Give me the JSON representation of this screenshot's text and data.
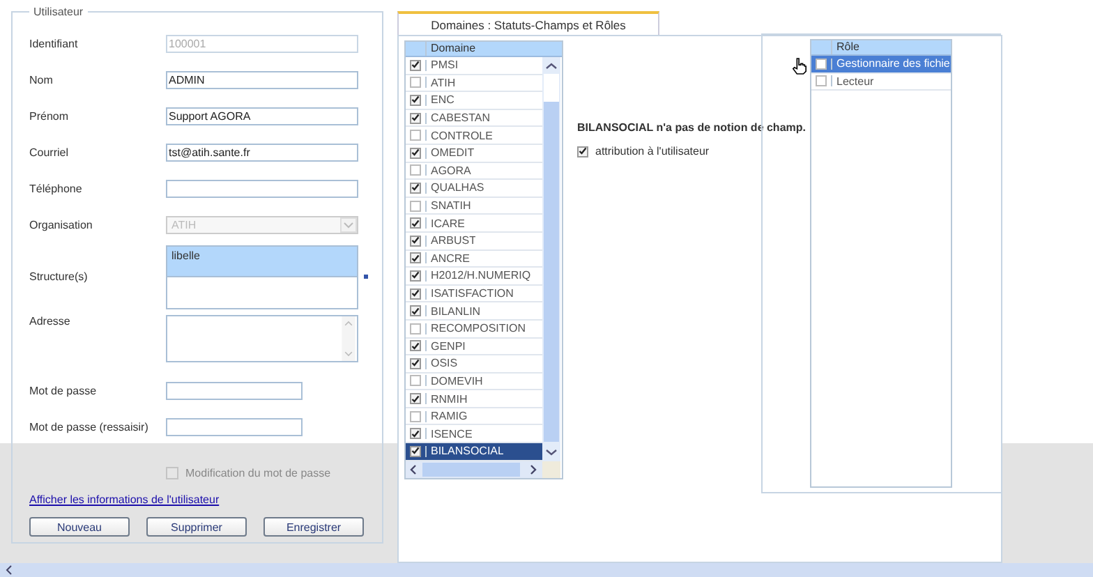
{
  "user_form": {
    "legend": "Utilisateur",
    "fields": [
      {
        "kind": "text",
        "label": "Identifiant",
        "value": "100001",
        "disabled": true
      },
      {
        "kind": "text",
        "label": "Nom",
        "value": "ADMIN",
        "disabled": false
      },
      {
        "kind": "text",
        "label": "Prénom",
        "value": "Support AGORA",
        "disabled": false
      },
      {
        "kind": "text",
        "label": "Courriel",
        "value": "tst@atih.sante.fr",
        "disabled": false
      },
      {
        "kind": "text",
        "label": "Téléphone",
        "disabled": false
      },
      {
        "kind": "select",
        "label": "Organisation",
        "value": "ATIH",
        "disabled": true
      },
      {
        "kind": "list",
        "label": "Structure(s)",
        "header": "libelle"
      },
      {
        "kind": "textarea",
        "label": "Adresse"
      },
      {
        "kind": "password",
        "label": "Mot de passe"
      },
      {
        "kind": "password",
        "label": "Mot de passe (ressaisir)"
      }
    ],
    "password_change": {
      "label": "Modification du mot de passe",
      "checked": false,
      "disabled": true
    },
    "info_link": "Afficher les informations de l'utilisateur",
    "buttons": [
      "Nouveau",
      "Supprimer",
      "Enregistrer"
    ]
  },
  "tabs": [
    {
      "label": "Domaines : Statuts-Champs et Rôles",
      "selected": true
    }
  ],
  "domains": {
    "header": "Domaine",
    "rows": [
      {
        "name": "PMSI",
        "checked": true,
        "selected": false
      },
      {
        "name": "ATIH",
        "checked": false,
        "selected": false
      },
      {
        "name": "ENC",
        "checked": true,
        "selected": false
      },
      {
        "name": "CABESTAN",
        "checked": true,
        "selected": false
      },
      {
        "name": "CONTROLE",
        "checked": false,
        "selected": false
      },
      {
        "name": "OMEDIT",
        "checked": true,
        "selected": false
      },
      {
        "name": "AGORA",
        "checked": false,
        "selected": false
      },
      {
        "name": "QUALHAS",
        "checked": true,
        "selected": false
      },
      {
        "name": "SNATIH",
        "checked": false,
        "selected": false
      },
      {
        "name": "ICARE",
        "checked": true,
        "selected": false
      },
      {
        "name": "ARBUST",
        "checked": true,
        "selected": false
      },
      {
        "name": "ANCRE",
        "checked": true,
        "selected": false
      },
      {
        "name": "H2012/H.NUMERIQ",
        "checked": true,
        "selected": false
      },
      {
        "name": "ISATISFACTION",
        "checked": true,
        "selected": false
      },
      {
        "name": "BILANLIN",
        "checked": true,
        "selected": false
      },
      {
        "name": "RECOMPOSITION",
        "checked": false,
        "selected": false
      },
      {
        "name": "GENPI",
        "checked": true,
        "selected": false
      },
      {
        "name": "OSIS",
        "checked": true,
        "selected": false
      },
      {
        "name": "DOMEVIH",
        "checked": false,
        "selected": false
      },
      {
        "name": "RNMIH",
        "checked": true,
        "selected": false
      },
      {
        "name": "RAMIG",
        "checked": false,
        "selected": false
      },
      {
        "name": "ISENCE",
        "checked": true,
        "selected": false
      },
      {
        "name": "BILANSOCIAL",
        "checked": true,
        "selected": true
      }
    ]
  },
  "domain_detail": {
    "message": "BILANSOCIAL n'a pas de notion de champ.",
    "attribution": {
      "label": "attribution à l'utilisateur",
      "checked": true
    }
  },
  "roles": {
    "header": "Rôle",
    "rows": [
      {
        "name": "Gestionnaire des fichie",
        "checked": false,
        "selected": true
      },
      {
        "name": "Lecteur",
        "checked": false,
        "selected": false
      }
    ]
  }
}
